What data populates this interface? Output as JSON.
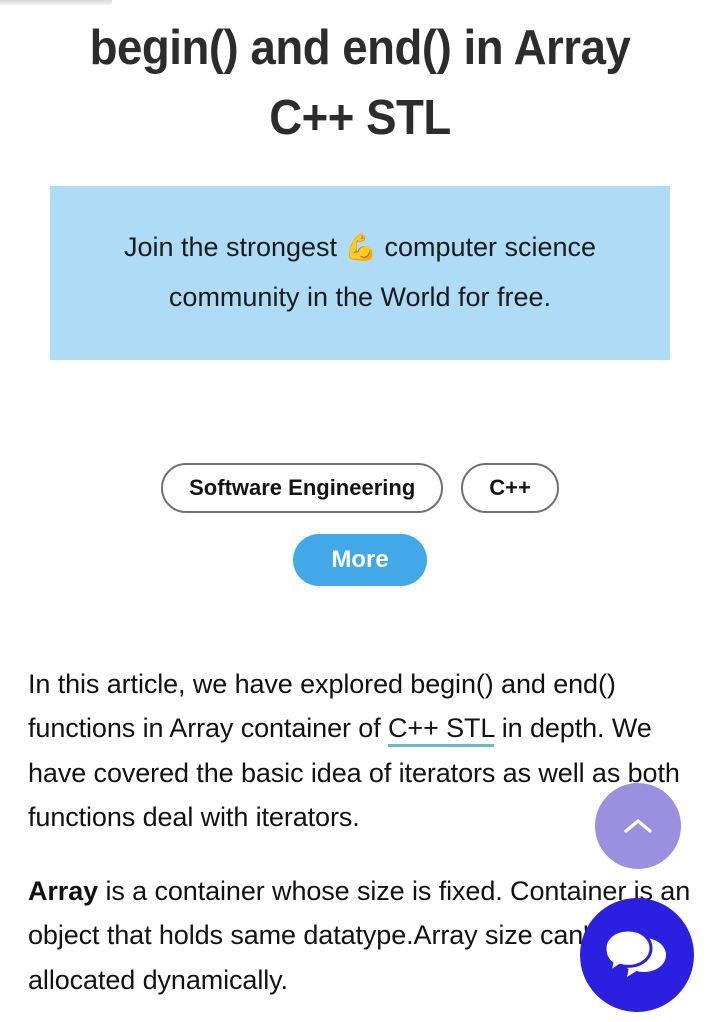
{
  "article": {
    "title": "begin() and end() in Array C++ STL",
    "paragraphs": [
      {
        "segments": [
          {
            "type": "text",
            "text": "In this article, we have explored begin() and end() functions in Array container of "
          },
          {
            "type": "link",
            "text": "C++ STL"
          },
          {
            "type": "text",
            "text": " in depth. We have covered the basic idea of iterators as well as both functions deal with iterators."
          }
        ]
      },
      {
        "segments": [
          {
            "type": "bold",
            "text": "Array"
          },
          {
            "type": "text",
            "text": " is a container whose size is fixed. Container is an object that holds same datatype.Array size can't be allocated dynamically."
          }
        ]
      }
    ]
  },
  "promo_banner": {
    "text_before_emoji": "Join the strongest ",
    "emoji": "💪",
    "text_after_emoji": " computer science community in the World for free.",
    "background_color": "#aedcf7"
  },
  "tags": [
    {
      "label": "Software Engineering"
    },
    {
      "label": "C++"
    }
  ],
  "more_button": {
    "label": "More",
    "color": "#42a8e8"
  },
  "floating_buttons": {
    "scroll_top": {
      "icon": "chevron-up-icon",
      "color": "#9b8fe0"
    },
    "chat": {
      "icon": "chat-bubbles-icon",
      "color": "#2b20e0"
    }
  },
  "link_underline_color": "#6cb8cc"
}
